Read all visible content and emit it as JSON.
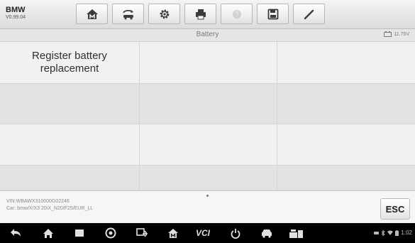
{
  "header": {
    "brand": "BMW",
    "version": "V0.99.04",
    "toolbar": [
      {
        "icon": "home-icon"
      },
      {
        "icon": "vehicle-swap-icon"
      },
      {
        "icon": "settings-gear-icon"
      },
      {
        "icon": "print-icon"
      },
      {
        "icon": "help-icon",
        "disabled": true
      },
      {
        "icon": "save-icon"
      },
      {
        "icon": "edit-pen-icon"
      }
    ]
  },
  "title_bar": {
    "title": "Battery",
    "battery_voltage": "11.75V",
    "battery_icon": "car-battery-icon"
  },
  "functions": [
    {
      "label": "Register battery replacement"
    }
  ],
  "footer": {
    "vin": "VIN:WBAWX310000G02246",
    "car": "Car: bmw/X/X3 20iX_N20/F25/EUR_LL",
    "esc_label": "ESC"
  },
  "navbar": {
    "items": [
      {
        "icon": "back-icon"
      },
      {
        "icon": "home-nav-icon"
      },
      {
        "icon": "recent-apps-icon"
      },
      {
        "icon": "browser-icon"
      },
      {
        "icon": "screen-switch-icon"
      },
      {
        "icon": "diagnostics-home-icon"
      },
      {
        "icon": "vci-icon",
        "label": "VCI"
      },
      {
        "icon": "power-icon"
      },
      {
        "icon": "car-icon"
      },
      {
        "icon": "shop-icon"
      }
    ],
    "status": {
      "time": "1:02",
      "icons": [
        "notification-icon",
        "bluetooth-icon",
        "wifi-icon",
        "battery-icon"
      ]
    }
  },
  "colors": {
    "toolbar_gradient_top": "#f4f4f4",
    "grid_light": "#f1f1f1",
    "grid_dark": "#e3e3e3",
    "navbar": "#000000"
  }
}
